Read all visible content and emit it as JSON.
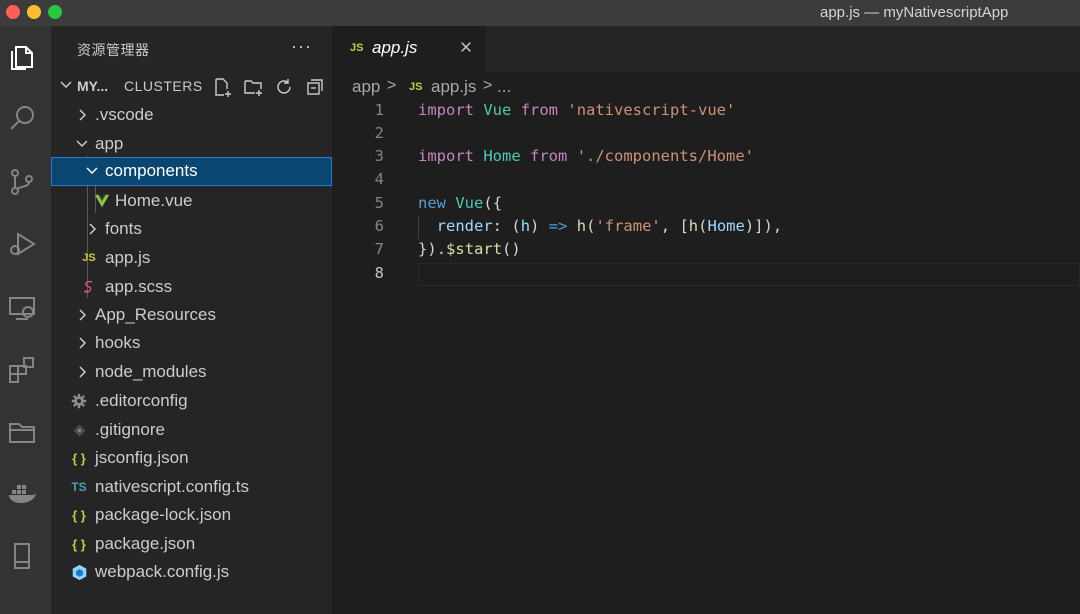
{
  "window": {
    "title": "app.js — myNativescriptApp"
  },
  "activity_bar": {
    "icons": [
      "explorer-icon",
      "search-icon",
      "source-control-icon",
      "run-debug-icon",
      "remote-explorer-icon",
      "extensions-icon",
      "folder-icon",
      "docker-icon",
      "device-icon"
    ]
  },
  "sidebar": {
    "title": "资源管理器",
    "more": "···",
    "section": {
      "name": "MY...",
      "secondary": "CLUSTERS"
    },
    "items": [
      {
        "label": ".vscode",
        "type": "folder",
        "expanded": false
      },
      {
        "label": "app",
        "type": "folder",
        "expanded": true
      },
      {
        "label": "components",
        "type": "folder",
        "expanded": true,
        "selected": true
      },
      {
        "label": "Home.vue",
        "type": "vue"
      },
      {
        "label": "fonts",
        "type": "folder",
        "expanded": false
      },
      {
        "label": "app.js",
        "type": "js",
        "icon_text": "JS"
      },
      {
        "label": "app.scss",
        "type": "scss"
      },
      {
        "label": "App_Resources",
        "type": "folder",
        "expanded": false
      },
      {
        "label": "hooks",
        "type": "folder",
        "expanded": false
      },
      {
        "label": "node_modules",
        "type": "folder",
        "expanded": false
      },
      {
        "label": ".editorconfig",
        "type": "config"
      },
      {
        "label": ".gitignore",
        "type": "git"
      },
      {
        "label": "jsconfig.json",
        "type": "json",
        "icon_text": "{ }"
      },
      {
        "label": "nativescript.config.ts",
        "type": "ts",
        "icon_text": "TS"
      },
      {
        "label": "package-lock.json",
        "type": "json",
        "icon_text": "{ }"
      },
      {
        "label": "package.json",
        "type": "json",
        "icon_text": "{ }"
      },
      {
        "label": "webpack.config.js",
        "type": "webpack"
      }
    ]
  },
  "editor": {
    "tab": {
      "icon_text": "JS",
      "label": "app.js"
    },
    "breadcrumb": {
      "folder": "app",
      "sep": ">",
      "icon_text": "JS",
      "file": "app.js",
      "sep2": ">",
      "more": "..."
    },
    "lines": [
      {
        "num": "1",
        "text": "import Vue from 'nativescript-vue'"
      },
      {
        "num": "2",
        "text": ""
      },
      {
        "num": "3",
        "text": "import Home from './components/Home'"
      },
      {
        "num": "4",
        "text": ""
      },
      {
        "num": "5",
        "text": "new Vue({"
      },
      {
        "num": "6",
        "text": "  render: (h) => h('frame', [h(Home)]),"
      },
      {
        "num": "7",
        "text": "}).$start()"
      },
      {
        "num": "8",
        "text": ""
      }
    ]
  },
  "colors": {
    "title_bar": "#3c3c3c",
    "activity_bar": "#333333",
    "sidebar": "#252526",
    "editor": "#1e1e1e",
    "selection": "#094771",
    "selection_border": "#2b79d8",
    "js_icon": "#cbcb41",
    "vue_icon": "#8dc149",
    "ts_icon": "#519aba",
    "json_icon": "#cbcb41"
  }
}
